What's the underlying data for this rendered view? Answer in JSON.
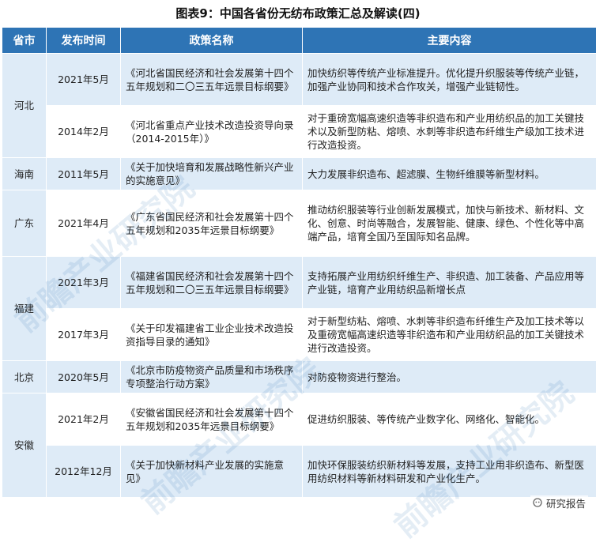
{
  "title": "图表9：中国各省份无纺布政策汇总及解读(四)",
  "headers": [
    "省市",
    "发布时间",
    "政策名称",
    "主要内容"
  ],
  "provinces": [
    {
      "name": "河北",
      "rows": [
        {
          "date": "2021年5月",
          "policy": "《河北省国民经济和社会发展第十四个五年规划和二〇三五年远景目标纲要》",
          "content": "加快纺织等传统产业标准提升。优化提升织服装等传统产业链，加强产业协同和技术合作攻关，增强产业链韧性。"
        },
        {
          "date": "2014年2月",
          "policy": "《河北省重点产业技术改造投资导向录（2014-2015年）》",
          "content": "对于重磅宽幅高速织造等非织造布和产业用纺织品的加工关键技术以及新型防粘、熔喷、水刺等非织造布纤维生产级加工技术进行改造投资。"
        }
      ]
    },
    {
      "name": "海南",
      "rows": [
        {
          "date": "2011年5月",
          "policy": "《关于加快培育和发展战略性新兴产业的实施意见》",
          "content": "大力发展非织造布、超滤膜、生物纤维膜等新型材料。"
        }
      ]
    },
    {
      "name": "广东",
      "rows": [
        {
          "date": "2021年4月",
          "policy": "《广东省国民经济和社会发展第十四个五年规划和2035年远景目标纲要》",
          "content": "推动纺织服装等行业创新发展模式，加快与新技术、新材料、文化、创意、时尚等融合，发展智能、健康、绿色、个性化等中高端产品，培育全国乃至国际知名品牌。"
        }
      ]
    },
    {
      "name": "福建",
      "rows": [
        {
          "date": "2021年3月",
          "policy": "《福建省国民经济和社会发展第十四个五年规划和二〇三五年远景目标纲要》",
          "content": "支持拓展产业用纺织纤维生产、非织造、加工装备、产品应用等产业链，培育产业用纺织品新增长点"
        },
        {
          "date": "2017年3月",
          "policy": "《关于印发福建省工业企业技术改造投资指导目录的通知》",
          "content": "对于新型纺粘、熔喷、水刺等非织造布纤维生产及加工技术等以及重磅宽幅高速织造等非织造布和产业用纺织品的加工关键技术进行改造投资。"
        }
      ]
    },
    {
      "name": "北京",
      "rows": [
        {
          "date": "2020年5月",
          "policy": "《北京市防疫物资产品质量和市场秩序专项整治行动方案》",
          "content": "对防疫物资进行整治。"
        }
      ]
    },
    {
      "name": "安徽",
      "rows": [
        {
          "date": "2021年2月",
          "policy": "《安徽省国民经济和社会发展第十四个五年规划和2035年远景目标纲要》",
          "content": "促进纺织服装、等传统产业数字化、网络化、智能化。"
        },
        {
          "date": "2012年12月",
          "policy": "《关于加快新材料产业发展的实施意见》",
          "content": "加快环保服装纺织新材料等发展，支持工业用非织造布、新型医用纺织材料等新材料研发和产业化生产。"
        }
      ]
    }
  ],
  "watermark": "前瞻产业研究院",
  "credit": "研究报告"
}
